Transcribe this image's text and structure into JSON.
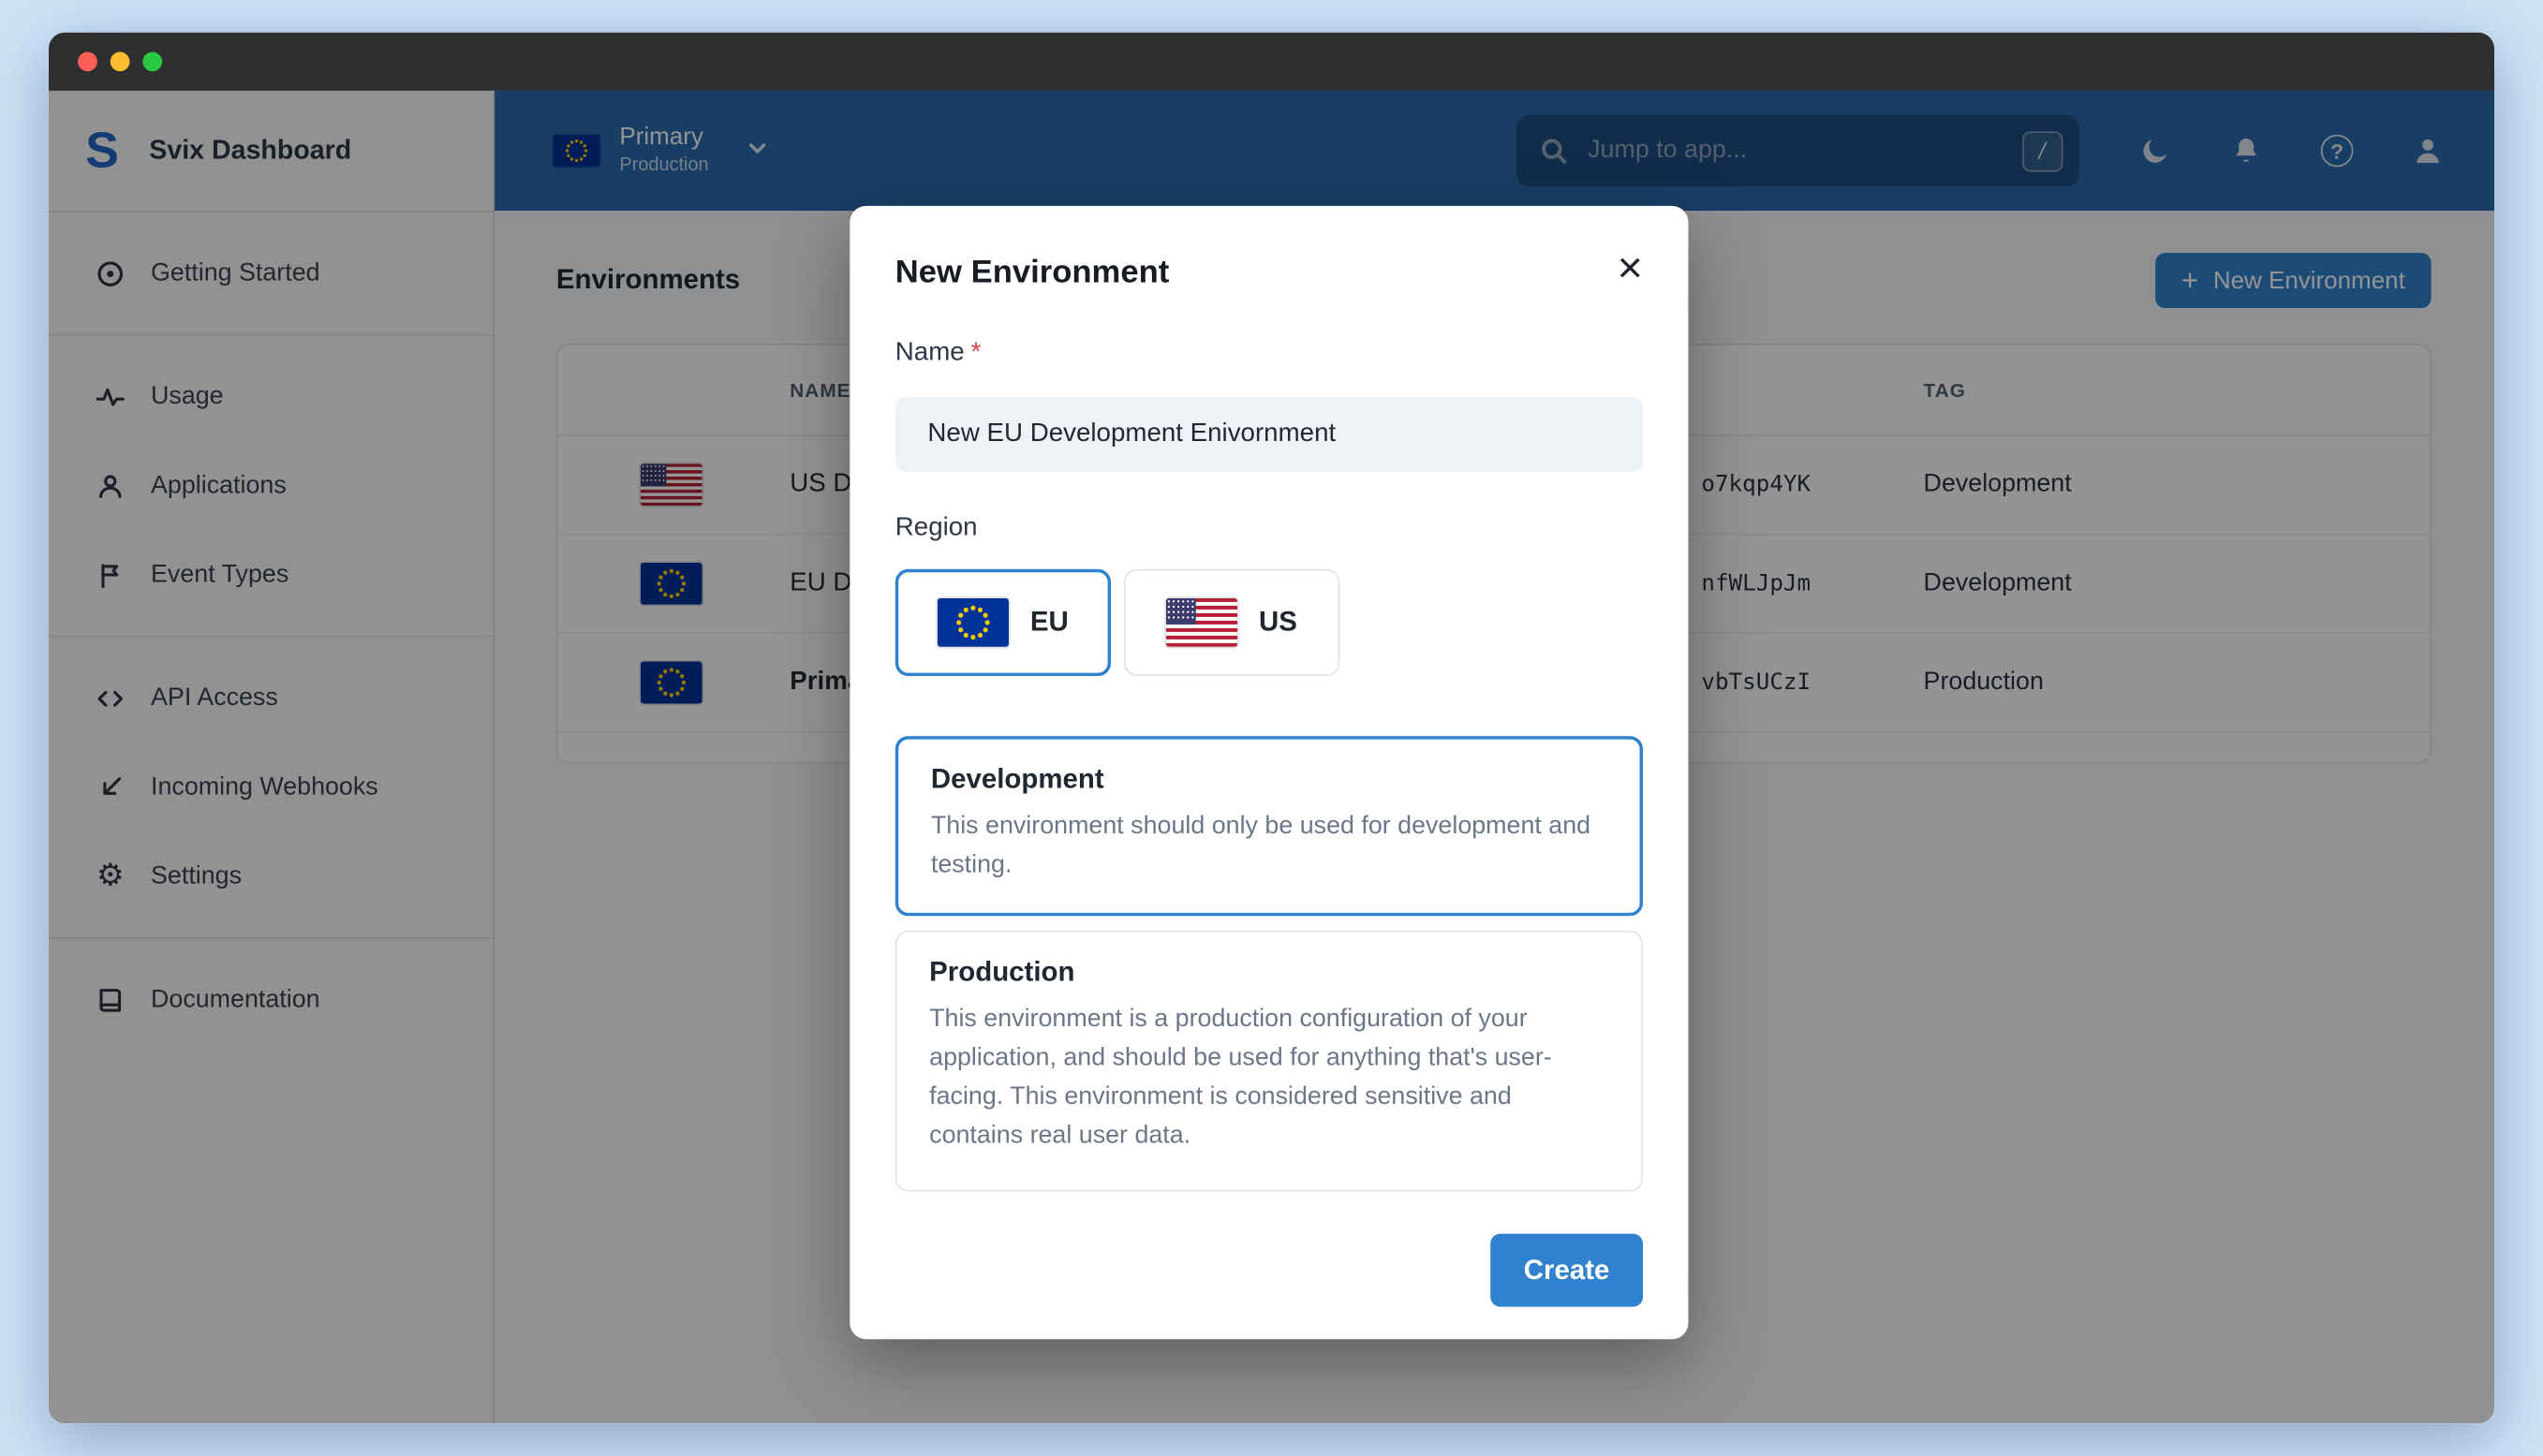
{
  "sidebar": {
    "logo_letter": "S",
    "brand": "Svix Dashboard",
    "items": [
      {
        "label": "Getting Started",
        "icon": "target-icon"
      },
      {
        "label": "Usage",
        "icon": "activity-icon"
      },
      {
        "label": "Applications",
        "icon": "person-icon"
      },
      {
        "label": "Event Types",
        "icon": "flag-icon"
      },
      {
        "label": "API Access",
        "icon": "code-icon"
      },
      {
        "label": "Incoming Webhooks",
        "icon": "arrow-down-left-icon"
      },
      {
        "label": "Settings",
        "icon": "gear-icon"
      },
      {
        "label": "Documentation",
        "icon": "book-icon"
      }
    ]
  },
  "topbar": {
    "env_flag": "eu",
    "env_name": "Primary",
    "env_tag": "Production",
    "search_placeholder": "Jump to app...",
    "search_shortcut": "/"
  },
  "main": {
    "title": "Environments",
    "new_env_button": "New Environment",
    "table": {
      "columns": [
        "NAME",
        "TAG"
      ],
      "rows": [
        {
          "flag": "us",
          "name": "US Development",
          "id_suffix": "o7kqp4YK",
          "tag": "Development"
        },
        {
          "flag": "eu",
          "name": "EU Development",
          "id_suffix": "nfWLJpJm",
          "tag": "Development"
        },
        {
          "flag": "eu",
          "name": "Primary",
          "id_suffix": "vbTsUCzI",
          "tag": "Production"
        }
      ]
    }
  },
  "modal": {
    "title": "New Environment",
    "close_glyph": "×",
    "name_label": "Name",
    "required_mark": "*",
    "name_value": "New EU Development Enivornment",
    "region_label": "Region",
    "regions": [
      {
        "label": "EU",
        "flag": "eu",
        "selected": true
      },
      {
        "label": "US",
        "flag": "us",
        "selected": false
      }
    ],
    "env_types": [
      {
        "title": "Development",
        "description": "This environment should only be used for development and testing.",
        "selected": true
      },
      {
        "title": "Production",
        "description": "This environment is a production configuration of your application, and should be used for anything that's user-facing. This environment is considered sensitive and contains real user data.",
        "selected": false
      }
    ],
    "create_button": "Create"
  },
  "colors": {
    "accent_blue": "#3182ce",
    "topbar_blue": "#2b6cb0",
    "page_background": "#cfe3f8",
    "required_red": "#e53e3e",
    "muted_text": "#6b7689"
  }
}
